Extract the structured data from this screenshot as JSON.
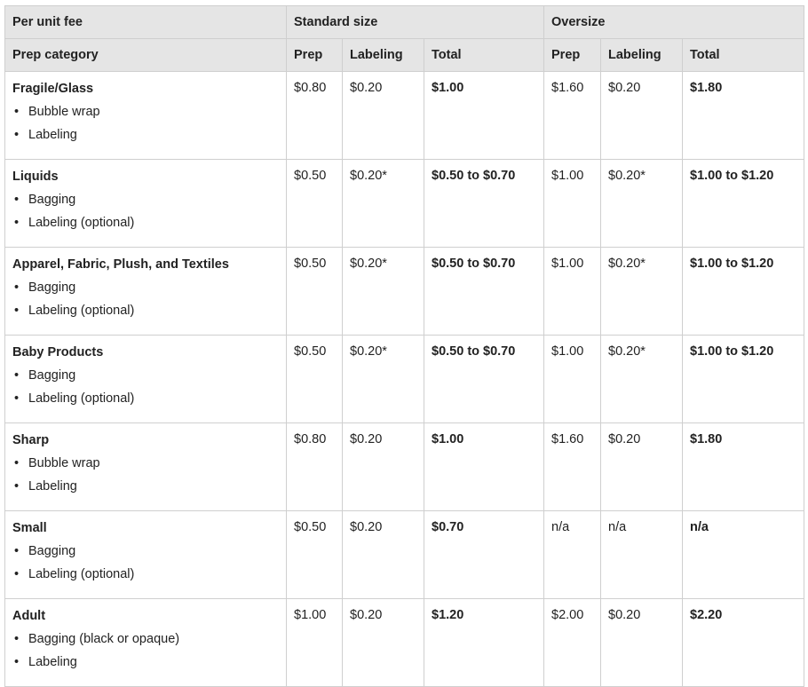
{
  "header": {
    "per_unit_fee": "Per unit fee",
    "standard_size": "Standard size",
    "oversize": "Oversize",
    "prep_category": "Prep category",
    "prep": "Prep",
    "labeling": "Labeling",
    "total": "Total"
  },
  "rows": [
    {
      "category": "Fragile/Glass",
      "items": [
        "Bubble wrap",
        "Labeling"
      ],
      "std_prep": "$0.80",
      "std_label": "$0.20",
      "std_total": "$1.00",
      "over_prep": "$1.60",
      "over_label": "$0.20",
      "over_total": "$1.80"
    },
    {
      "category": "Liquids",
      "items": [
        "Bagging",
        "Labeling (optional)"
      ],
      "std_prep": "$0.50",
      "std_label": "$0.20*",
      "std_total": "$0.50 to $0.70",
      "over_prep": "$1.00",
      "over_label": "$0.20*",
      "over_total": "$1.00 to $1.20"
    },
    {
      "category": "Apparel, Fabric, Plush, and Textiles",
      "items": [
        "Bagging",
        "Labeling (optional)"
      ],
      "std_prep": "$0.50",
      "std_label": "$0.20*",
      "std_total": "$0.50 to $0.70",
      "over_prep": "$1.00",
      "over_label": "$0.20*",
      "over_total": "$1.00 to $1.20"
    },
    {
      "category": "Baby Products",
      "items": [
        "Bagging",
        "Labeling (optional)"
      ],
      "std_prep": "$0.50",
      "std_label": "$0.20*",
      "std_total": "$0.50 to $0.70",
      "over_prep": "$1.00",
      "over_label": "$0.20*",
      "over_total": "$1.00 to $1.20"
    },
    {
      "category": "Sharp",
      "items": [
        "Bubble wrap",
        "Labeling"
      ],
      "std_prep": "$0.80",
      "std_label": "$0.20",
      "std_total": "$1.00",
      "over_prep": "$1.60",
      "over_label": "$0.20",
      "over_total": "$1.80"
    },
    {
      "category": "Small",
      "items": [
        "Bagging",
        "Labeling (optional)"
      ],
      "std_prep": "$0.50",
      "std_label": "$0.20",
      "std_total": "$0.70",
      "over_prep": "n/a",
      "over_label": "n/a",
      "over_total": "n/a"
    },
    {
      "category": "Adult",
      "items": [
        "Bagging (black or opaque)",
        "Labeling"
      ],
      "std_prep": "$1.00",
      "std_label": "$0.20",
      "std_total": "$1.20",
      "over_prep": "$2.00",
      "over_label": "$0.20",
      "over_total": "$2.20"
    }
  ]
}
